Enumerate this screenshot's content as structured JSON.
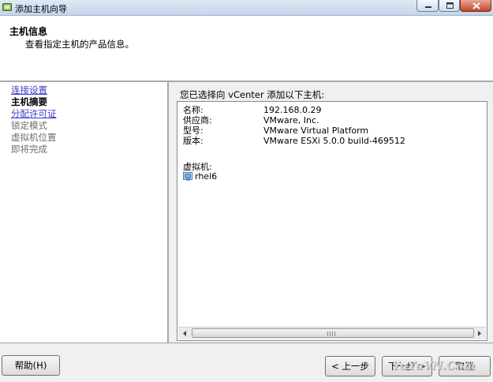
{
  "window": {
    "title": "添加主机向导"
  },
  "header": {
    "title": "主机信息",
    "subtitle": "查看指定主机的产品信息。"
  },
  "nav": {
    "items": [
      {
        "label": "连接设置",
        "state": "link"
      },
      {
        "label": "主机摘要",
        "state": "active"
      },
      {
        "label": "分配许可证",
        "state": "link"
      },
      {
        "label": "锁定模式",
        "state": "disabled"
      },
      {
        "label": "虚拟机位置",
        "state": "disabled"
      },
      {
        "label": "即将完成",
        "state": "disabled"
      }
    ]
  },
  "main": {
    "intro": "您已选择向 vCenter 添加以下主机:",
    "properties": [
      {
        "key": "名称:",
        "value": "192.168.0.29"
      },
      {
        "key": "供应商:",
        "value": "VMware, Inc."
      },
      {
        "key": "型号:",
        "value": "VMware Virtual Platform"
      },
      {
        "key": "版本:",
        "value": "VMware ESXi 5.0.0 build-469512"
      }
    ],
    "vm_label": "虚拟机:",
    "vms": [
      {
        "name": "rhel6",
        "icon": "vm-icon"
      }
    ]
  },
  "footer": {
    "help": "帮助(H)",
    "back": "< 上一步",
    "next": "下一步 >",
    "cancel": "取消"
  },
  "watermark": "YuYuVN.Com",
  "colors": {
    "link": "#3b3bcc",
    "disabled": "#6e6e6e",
    "close_button": "#c2462c"
  }
}
